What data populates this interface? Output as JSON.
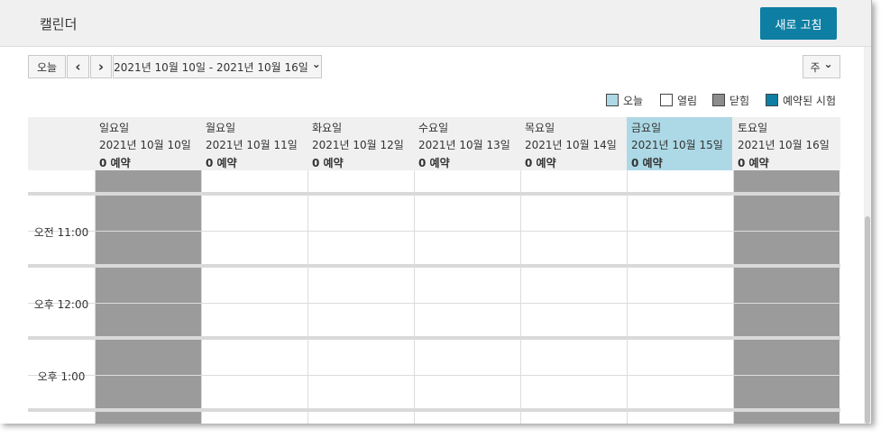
{
  "header": {
    "title": "캘린더",
    "refresh_label": "새로 고침"
  },
  "toolbar": {
    "today_label": "오늘",
    "prev_icon": "‹",
    "next_icon": "›",
    "date_range": "2021년 10월 10일 - 2021년 10월 16일",
    "view_label": "주",
    "dropdown_icon": "⌄"
  },
  "legend": {
    "items": [
      {
        "label": "오늘",
        "color": "#add9e6"
      },
      {
        "label": "열림",
        "color": "#ffffff"
      },
      {
        "label": "닫힘",
        "color": "#8c8c8c"
      },
      {
        "label": "예약된 시험",
        "color": "#0e7fa3"
      }
    ]
  },
  "calendar": {
    "days": [
      {
        "weekday": "일요일",
        "date": "2021년 10월 10일",
        "count": "0 예약",
        "status": "closed"
      },
      {
        "weekday": "월요일",
        "date": "2021년 10월 11일",
        "count": "0 예약",
        "status": "open"
      },
      {
        "weekday": "화요일",
        "date": "2021년 10월 12일",
        "count": "0 예약",
        "status": "open"
      },
      {
        "weekday": "수요일",
        "date": "2021년 10월 13일",
        "count": "0 예약",
        "status": "open"
      },
      {
        "weekday": "목요일",
        "date": "2021년 10월 14일",
        "count": "0 예약",
        "status": "open"
      },
      {
        "weekday": "금요일",
        "date": "2021년 10월 15일",
        "count": "0 예약",
        "status": "today"
      },
      {
        "weekday": "토요일",
        "date": "2021년 10월 16일",
        "count": "0 예약",
        "status": "closed"
      }
    ],
    "time_labels": [
      "오전 11:00",
      "오후 12:00",
      "오후 1:00"
    ]
  }
}
